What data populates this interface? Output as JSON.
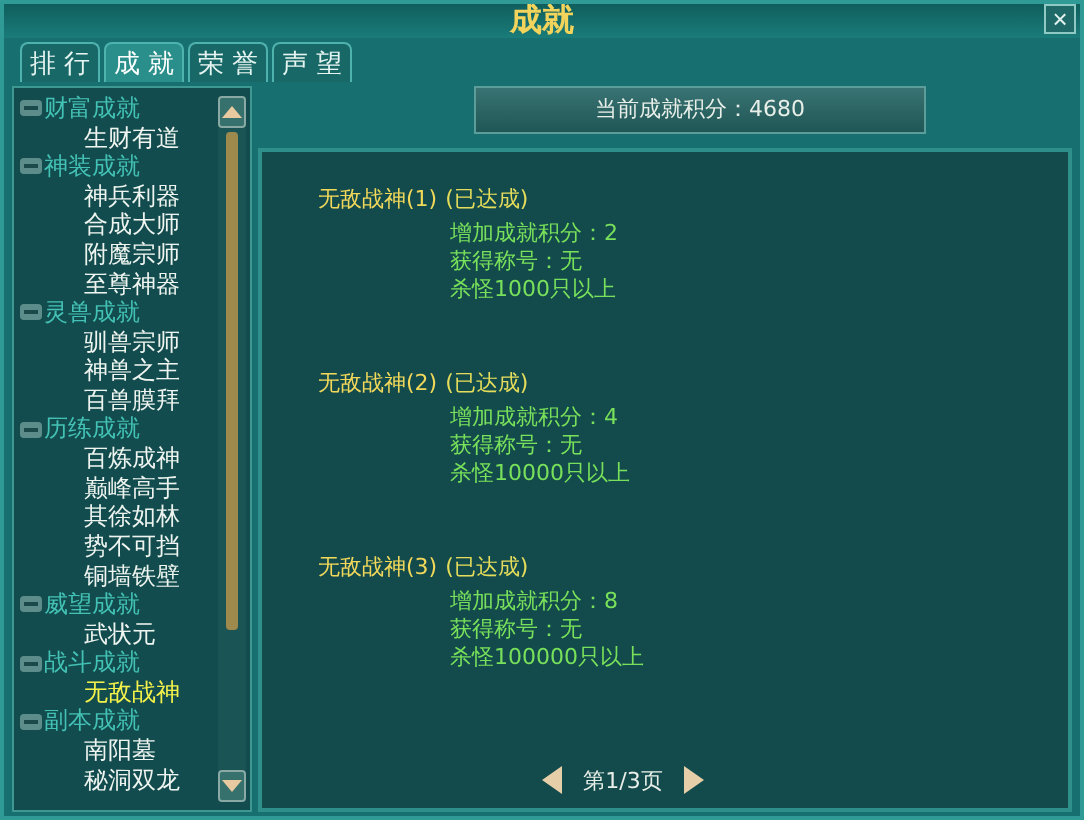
{
  "window": {
    "title": "成就",
    "close": "×"
  },
  "tabs": [
    {
      "label": "排 行",
      "selected": false
    },
    {
      "label": "成 就",
      "selected": true
    },
    {
      "label": "荣 誉",
      "selected": false
    },
    {
      "label": "声 望",
      "selected": false
    }
  ],
  "sidebar": {
    "groups": [
      {
        "label": "财富成就",
        "expanded": true,
        "children": [
          {
            "label": "生财有道",
            "selected": false
          }
        ]
      },
      {
        "label": "神装成就",
        "expanded": true,
        "children": [
          {
            "label": "神兵利器",
            "selected": false
          },
          {
            "label": "合成大师",
            "selected": false
          },
          {
            "label": "附魔宗师",
            "selected": false
          },
          {
            "label": "至尊神器",
            "selected": false
          }
        ]
      },
      {
        "label": "灵兽成就",
        "expanded": true,
        "children": [
          {
            "label": "驯兽宗师",
            "selected": false
          },
          {
            "label": "神兽之主",
            "selected": false
          },
          {
            "label": "百兽膜拜",
            "selected": false
          }
        ]
      },
      {
        "label": "历练成就",
        "expanded": true,
        "children": [
          {
            "label": "百炼成神",
            "selected": false
          },
          {
            "label": "巅峰高手",
            "selected": false
          },
          {
            "label": "其徐如林",
            "selected": false
          },
          {
            "label": "势不可挡",
            "selected": false
          },
          {
            "label": "铜墙铁壁",
            "selected": false
          }
        ]
      },
      {
        "label": "威望成就",
        "expanded": true,
        "children": [
          {
            "label": "武状元",
            "selected": false
          }
        ]
      },
      {
        "label": "战斗成就",
        "expanded": true,
        "children": [
          {
            "label": "无敌战神",
            "selected": true
          }
        ]
      },
      {
        "label": "副本成就",
        "expanded": true,
        "children": [
          {
            "label": "南阳墓",
            "selected": false
          },
          {
            "label": "秘洞双龙",
            "selected": false
          }
        ]
      }
    ]
  },
  "score": "当前成就积分：4680",
  "achievements": [
    {
      "name": "无敌战神(1)",
      "status": "(已达成)",
      "lines": [
        "增加成就积分：2",
        "获得称号：无",
        "杀怪1000只以上"
      ]
    },
    {
      "name": "无敌战神(2)",
      "status": "(已达成)",
      "lines": [
        "增加成就积分：4",
        "获得称号：无",
        "杀怪10000只以上"
      ]
    },
    {
      "name": "无敌战神(3)",
      "status": "(已达成)",
      "lines": [
        "增加成就积分：8",
        "获得称号：无",
        "杀怪100000只以上"
      ]
    }
  ],
  "pager": {
    "label": "第1/3页"
  }
}
